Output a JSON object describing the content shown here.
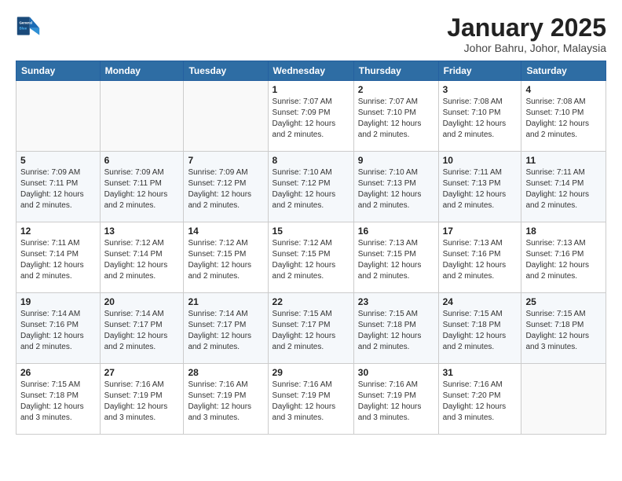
{
  "header": {
    "logo": {
      "general": "General",
      "blue": "Blue"
    },
    "title": "January 2025",
    "subtitle": "Johor Bahru, Johor, Malaysia"
  },
  "days_of_week": [
    "Sunday",
    "Monday",
    "Tuesday",
    "Wednesday",
    "Thursday",
    "Friday",
    "Saturday"
  ],
  "weeks": [
    [
      {
        "day": "",
        "info": ""
      },
      {
        "day": "",
        "info": ""
      },
      {
        "day": "",
        "info": ""
      },
      {
        "day": "1",
        "info": "Sunrise: 7:07 AM\nSunset: 7:09 PM\nDaylight: 12 hours\nand 2 minutes."
      },
      {
        "day": "2",
        "info": "Sunrise: 7:07 AM\nSunset: 7:10 PM\nDaylight: 12 hours\nand 2 minutes."
      },
      {
        "day": "3",
        "info": "Sunrise: 7:08 AM\nSunset: 7:10 PM\nDaylight: 12 hours\nand 2 minutes."
      },
      {
        "day": "4",
        "info": "Sunrise: 7:08 AM\nSunset: 7:10 PM\nDaylight: 12 hours\nand 2 minutes."
      }
    ],
    [
      {
        "day": "5",
        "info": "Sunrise: 7:09 AM\nSunset: 7:11 PM\nDaylight: 12 hours\nand 2 minutes."
      },
      {
        "day": "6",
        "info": "Sunrise: 7:09 AM\nSunset: 7:11 PM\nDaylight: 12 hours\nand 2 minutes."
      },
      {
        "day": "7",
        "info": "Sunrise: 7:09 AM\nSunset: 7:12 PM\nDaylight: 12 hours\nand 2 minutes."
      },
      {
        "day": "8",
        "info": "Sunrise: 7:10 AM\nSunset: 7:12 PM\nDaylight: 12 hours\nand 2 minutes."
      },
      {
        "day": "9",
        "info": "Sunrise: 7:10 AM\nSunset: 7:13 PM\nDaylight: 12 hours\nand 2 minutes."
      },
      {
        "day": "10",
        "info": "Sunrise: 7:11 AM\nSunset: 7:13 PM\nDaylight: 12 hours\nand 2 minutes."
      },
      {
        "day": "11",
        "info": "Sunrise: 7:11 AM\nSunset: 7:14 PM\nDaylight: 12 hours\nand 2 minutes."
      }
    ],
    [
      {
        "day": "12",
        "info": "Sunrise: 7:11 AM\nSunset: 7:14 PM\nDaylight: 12 hours\nand 2 minutes."
      },
      {
        "day": "13",
        "info": "Sunrise: 7:12 AM\nSunset: 7:14 PM\nDaylight: 12 hours\nand 2 minutes."
      },
      {
        "day": "14",
        "info": "Sunrise: 7:12 AM\nSunset: 7:15 PM\nDaylight: 12 hours\nand 2 minutes."
      },
      {
        "day": "15",
        "info": "Sunrise: 7:12 AM\nSunset: 7:15 PM\nDaylight: 12 hours\nand 2 minutes."
      },
      {
        "day": "16",
        "info": "Sunrise: 7:13 AM\nSunset: 7:15 PM\nDaylight: 12 hours\nand 2 minutes."
      },
      {
        "day": "17",
        "info": "Sunrise: 7:13 AM\nSunset: 7:16 PM\nDaylight: 12 hours\nand 2 minutes."
      },
      {
        "day": "18",
        "info": "Sunrise: 7:13 AM\nSunset: 7:16 PM\nDaylight: 12 hours\nand 2 minutes."
      }
    ],
    [
      {
        "day": "19",
        "info": "Sunrise: 7:14 AM\nSunset: 7:16 PM\nDaylight: 12 hours\nand 2 minutes."
      },
      {
        "day": "20",
        "info": "Sunrise: 7:14 AM\nSunset: 7:17 PM\nDaylight: 12 hours\nand 2 minutes."
      },
      {
        "day": "21",
        "info": "Sunrise: 7:14 AM\nSunset: 7:17 PM\nDaylight: 12 hours\nand 2 minutes."
      },
      {
        "day": "22",
        "info": "Sunrise: 7:15 AM\nSunset: 7:17 PM\nDaylight: 12 hours\nand 2 minutes."
      },
      {
        "day": "23",
        "info": "Sunrise: 7:15 AM\nSunset: 7:18 PM\nDaylight: 12 hours\nand 2 minutes."
      },
      {
        "day": "24",
        "info": "Sunrise: 7:15 AM\nSunset: 7:18 PM\nDaylight: 12 hours\nand 2 minutes."
      },
      {
        "day": "25",
        "info": "Sunrise: 7:15 AM\nSunset: 7:18 PM\nDaylight: 12 hours\nand 3 minutes."
      }
    ],
    [
      {
        "day": "26",
        "info": "Sunrise: 7:15 AM\nSunset: 7:18 PM\nDaylight: 12 hours\nand 3 minutes."
      },
      {
        "day": "27",
        "info": "Sunrise: 7:16 AM\nSunset: 7:19 PM\nDaylight: 12 hours\nand 3 minutes."
      },
      {
        "day": "28",
        "info": "Sunrise: 7:16 AM\nSunset: 7:19 PM\nDaylight: 12 hours\nand 3 minutes."
      },
      {
        "day": "29",
        "info": "Sunrise: 7:16 AM\nSunset: 7:19 PM\nDaylight: 12 hours\nand 3 minutes."
      },
      {
        "day": "30",
        "info": "Sunrise: 7:16 AM\nSunset: 7:19 PM\nDaylight: 12 hours\nand 3 minutes."
      },
      {
        "day": "31",
        "info": "Sunrise: 7:16 AM\nSunset: 7:20 PM\nDaylight: 12 hours\nand 3 minutes."
      },
      {
        "day": "",
        "info": ""
      }
    ]
  ]
}
